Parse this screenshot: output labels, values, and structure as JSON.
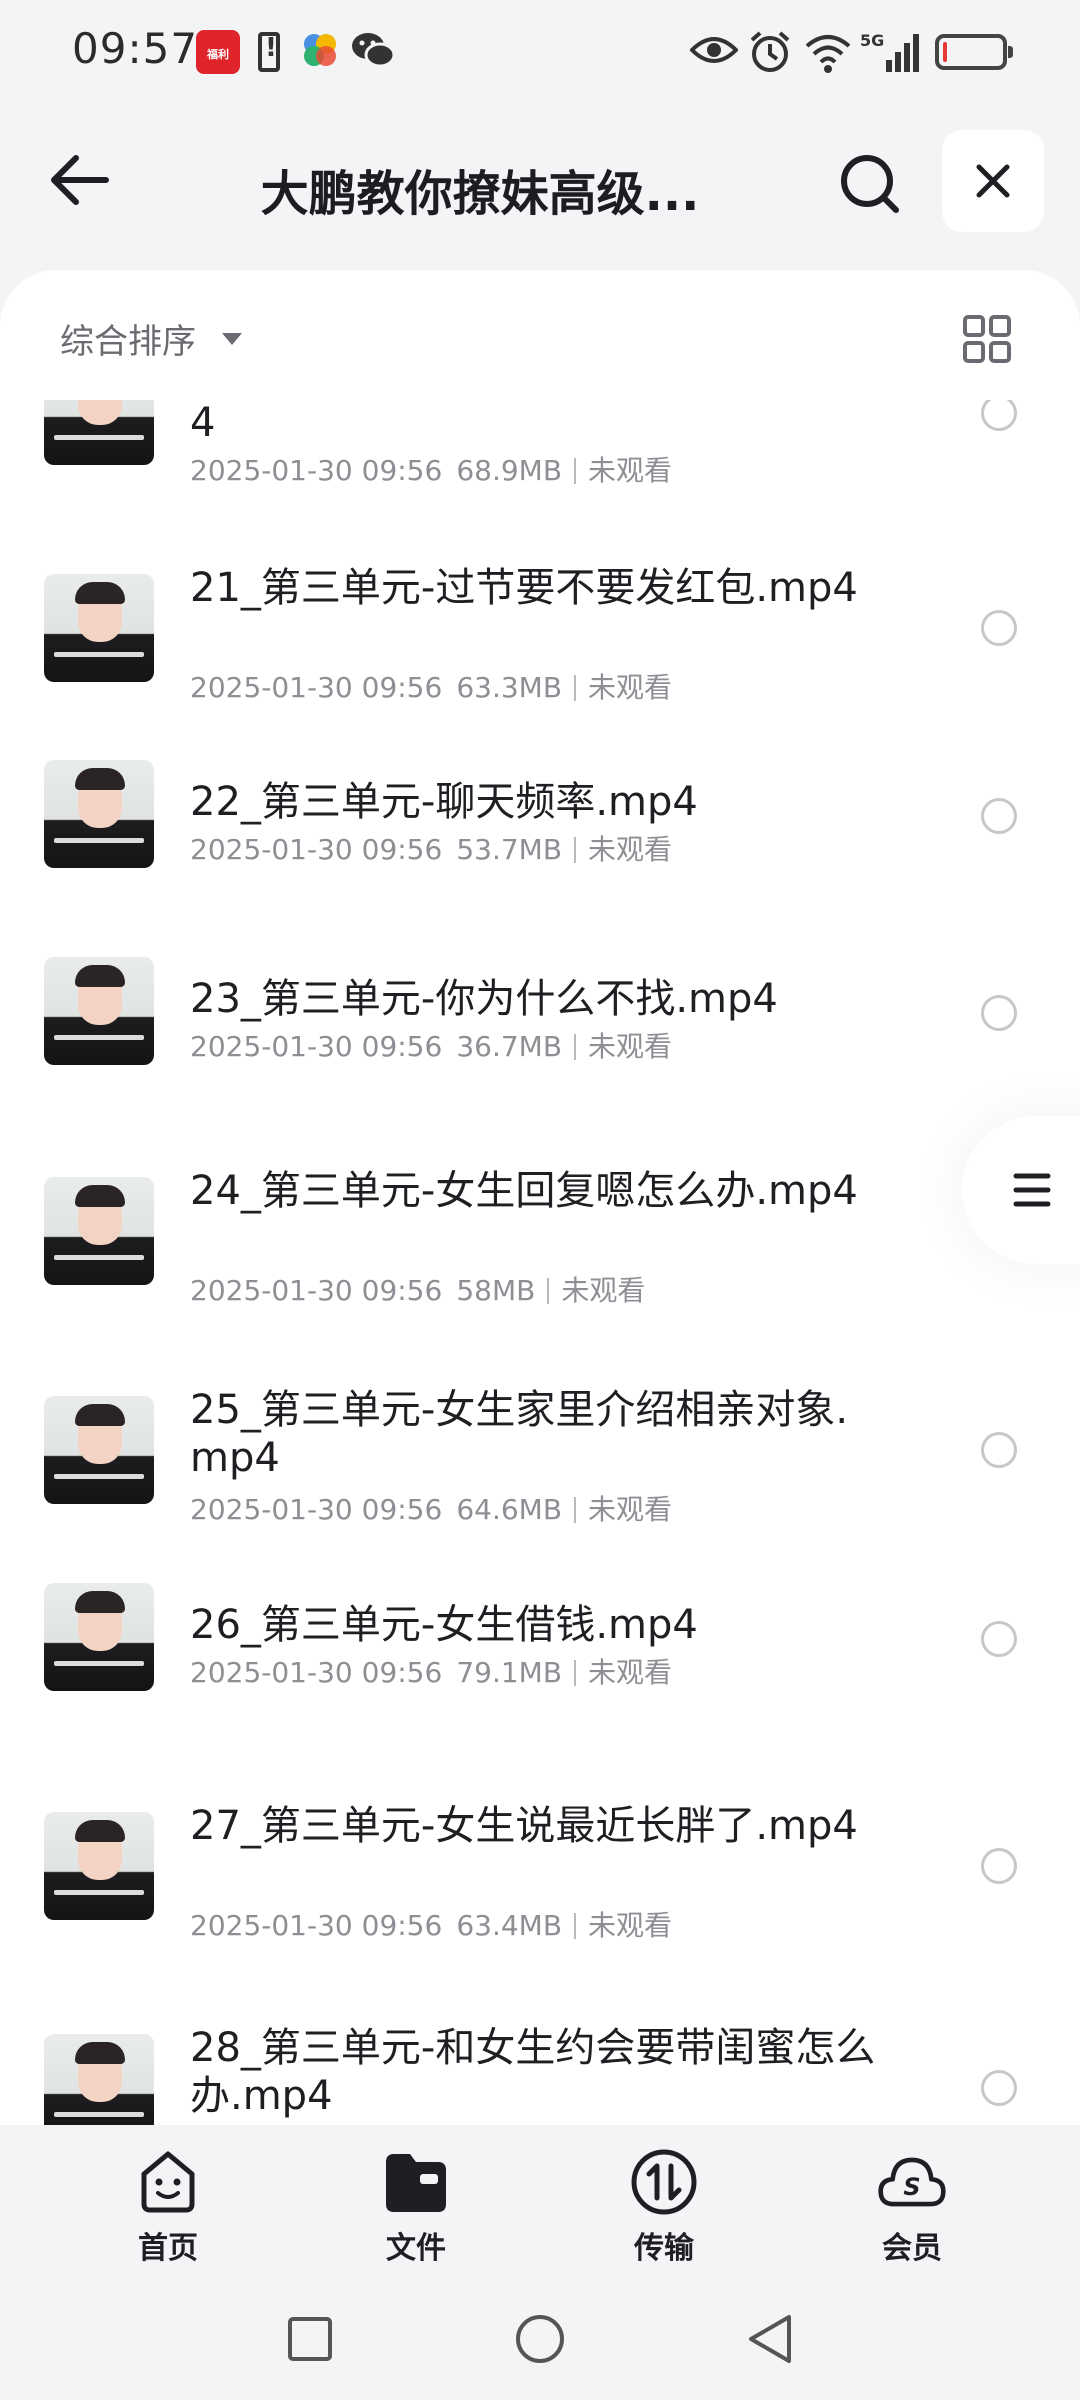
{
  "status_bar": {
    "time": "09:57",
    "app_badge": "福利"
  },
  "header": {
    "title": "大鹏教你撩妹高级..."
  },
  "toolbar": {
    "sort_label": "综合排序"
  },
  "files": [
    {
      "name": "4",
      "date": "2025-01-30 09:56",
      "size": "68.9MB",
      "status": "未观看"
    },
    {
      "name": "21_第三单元-过节要不要发红包.mp4",
      "date": "2025-01-30 09:56",
      "size": "63.3MB",
      "status": "未观看"
    },
    {
      "name": "22_第三单元-聊天频率.mp4",
      "date": "2025-01-30 09:56",
      "size": "53.7MB",
      "status": "未观看"
    },
    {
      "name": "23_第三单元-你为什么不找.mp4",
      "date": "2025-01-30 09:56",
      "size": "36.7MB",
      "status": "未观看"
    },
    {
      "name": "24_第三单元-女生回复嗯怎么办.mp4",
      "date": "2025-01-30 09:56",
      "size": "58MB",
      "status": "未观看"
    },
    {
      "name": "25_第三单元-女生家里介绍相亲对象.mp4",
      "date": "2025-01-30 09:56",
      "size": "64.6MB",
      "status": "未观看"
    },
    {
      "name": "26_第三单元-女生借钱.mp4",
      "date": "2025-01-30 09:56",
      "size": "79.1MB",
      "status": "未观看"
    },
    {
      "name": "27_第三单元-女生说最近长胖了.mp4",
      "date": "2025-01-30 09:56",
      "size": "63.4MB",
      "status": "未观看"
    },
    {
      "name": "28_第三单元-和女生约会要带闺蜜怎么办.mp4",
      "date": "",
      "size": "",
      "status": ""
    }
  ],
  "bottom_nav": [
    {
      "label": "首页",
      "icon": "home-smile-icon"
    },
    {
      "label": "文件",
      "icon": "folder-icon"
    },
    {
      "label": "传输",
      "icon": "transfer-icon"
    },
    {
      "label": "会员",
      "icon": "vip-cloud-icon"
    }
  ],
  "colors": {
    "background": "#f3f4f6",
    "card": "#ffffff",
    "text_primary": "#1e1f23",
    "text_secondary": "#8e8f94",
    "battery_low": "#e53935"
  }
}
